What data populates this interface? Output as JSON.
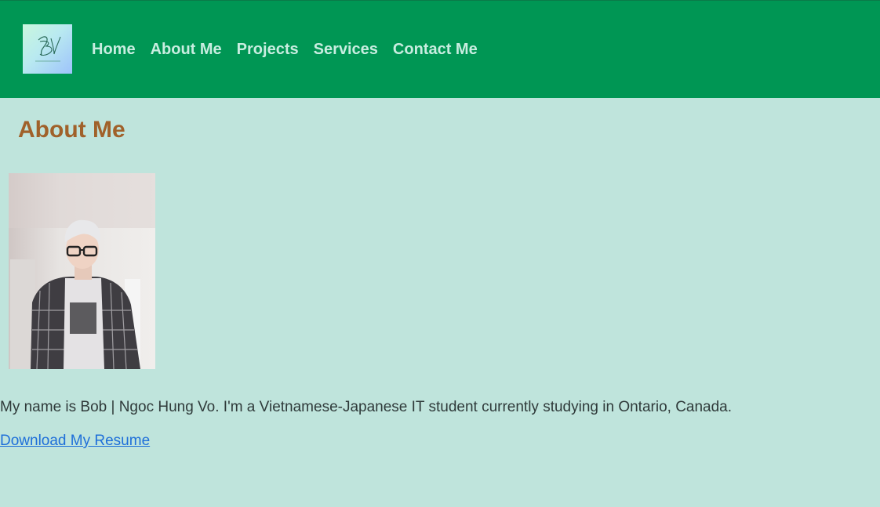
{
  "header": {
    "logo_text": "BV",
    "nav": [
      {
        "label": "Home"
      },
      {
        "label": "About Me"
      },
      {
        "label": "Projects"
      },
      {
        "label": "Services"
      },
      {
        "label": "Contact Me"
      }
    ]
  },
  "main": {
    "title": "About Me",
    "photo_icon": "profile-photo",
    "bio": "My name is Bob | Ngoc Hung Vo. I'm a Vietnamese-Japanese IT student currently studying in Ontario, Canada.",
    "resume_link": "Download My Resume"
  },
  "colors": {
    "header_bg": "#009654",
    "page_bg": "#bfe4dc",
    "nav_text": "#c8ede0",
    "title": "#a0612a",
    "link": "#1e6fd9",
    "body_text": "#2f3a3a"
  }
}
